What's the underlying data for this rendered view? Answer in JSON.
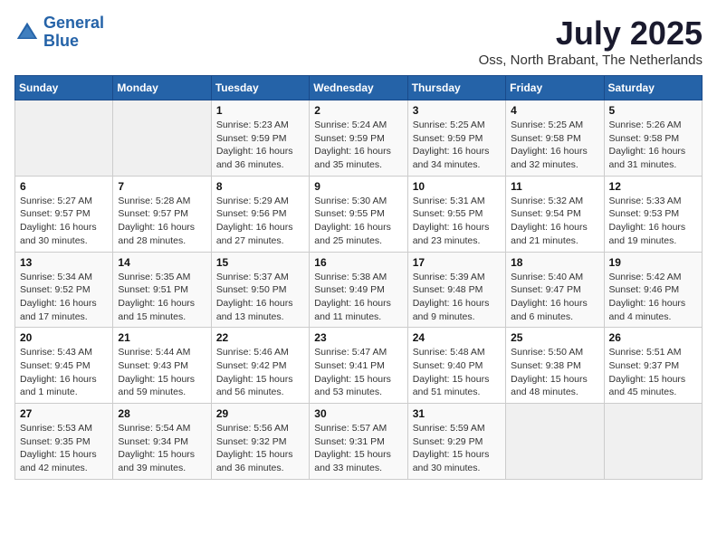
{
  "header": {
    "logo_line1": "General",
    "logo_line2": "Blue",
    "month_year": "July 2025",
    "location": "Oss, North Brabant, The Netherlands"
  },
  "weekdays": [
    "Sunday",
    "Monday",
    "Tuesday",
    "Wednesday",
    "Thursday",
    "Friday",
    "Saturday"
  ],
  "weeks": [
    [
      {
        "day": "",
        "info": ""
      },
      {
        "day": "",
        "info": ""
      },
      {
        "day": "1",
        "info": "Sunrise: 5:23 AM\nSunset: 9:59 PM\nDaylight: 16 hours\nand 36 minutes."
      },
      {
        "day": "2",
        "info": "Sunrise: 5:24 AM\nSunset: 9:59 PM\nDaylight: 16 hours\nand 35 minutes."
      },
      {
        "day": "3",
        "info": "Sunrise: 5:25 AM\nSunset: 9:59 PM\nDaylight: 16 hours\nand 34 minutes."
      },
      {
        "day": "4",
        "info": "Sunrise: 5:25 AM\nSunset: 9:58 PM\nDaylight: 16 hours\nand 32 minutes."
      },
      {
        "day": "5",
        "info": "Sunrise: 5:26 AM\nSunset: 9:58 PM\nDaylight: 16 hours\nand 31 minutes."
      }
    ],
    [
      {
        "day": "6",
        "info": "Sunrise: 5:27 AM\nSunset: 9:57 PM\nDaylight: 16 hours\nand 30 minutes."
      },
      {
        "day": "7",
        "info": "Sunrise: 5:28 AM\nSunset: 9:57 PM\nDaylight: 16 hours\nand 28 minutes."
      },
      {
        "day": "8",
        "info": "Sunrise: 5:29 AM\nSunset: 9:56 PM\nDaylight: 16 hours\nand 27 minutes."
      },
      {
        "day": "9",
        "info": "Sunrise: 5:30 AM\nSunset: 9:55 PM\nDaylight: 16 hours\nand 25 minutes."
      },
      {
        "day": "10",
        "info": "Sunrise: 5:31 AM\nSunset: 9:55 PM\nDaylight: 16 hours\nand 23 minutes."
      },
      {
        "day": "11",
        "info": "Sunrise: 5:32 AM\nSunset: 9:54 PM\nDaylight: 16 hours\nand 21 minutes."
      },
      {
        "day": "12",
        "info": "Sunrise: 5:33 AM\nSunset: 9:53 PM\nDaylight: 16 hours\nand 19 minutes."
      }
    ],
    [
      {
        "day": "13",
        "info": "Sunrise: 5:34 AM\nSunset: 9:52 PM\nDaylight: 16 hours\nand 17 minutes."
      },
      {
        "day": "14",
        "info": "Sunrise: 5:35 AM\nSunset: 9:51 PM\nDaylight: 16 hours\nand 15 minutes."
      },
      {
        "day": "15",
        "info": "Sunrise: 5:37 AM\nSunset: 9:50 PM\nDaylight: 16 hours\nand 13 minutes."
      },
      {
        "day": "16",
        "info": "Sunrise: 5:38 AM\nSunset: 9:49 PM\nDaylight: 16 hours\nand 11 minutes."
      },
      {
        "day": "17",
        "info": "Sunrise: 5:39 AM\nSunset: 9:48 PM\nDaylight: 16 hours\nand 9 minutes."
      },
      {
        "day": "18",
        "info": "Sunrise: 5:40 AM\nSunset: 9:47 PM\nDaylight: 16 hours\nand 6 minutes."
      },
      {
        "day": "19",
        "info": "Sunrise: 5:42 AM\nSunset: 9:46 PM\nDaylight: 16 hours\nand 4 minutes."
      }
    ],
    [
      {
        "day": "20",
        "info": "Sunrise: 5:43 AM\nSunset: 9:45 PM\nDaylight: 16 hours\nand 1 minute."
      },
      {
        "day": "21",
        "info": "Sunrise: 5:44 AM\nSunset: 9:43 PM\nDaylight: 15 hours\nand 59 minutes."
      },
      {
        "day": "22",
        "info": "Sunrise: 5:46 AM\nSunset: 9:42 PM\nDaylight: 15 hours\nand 56 minutes."
      },
      {
        "day": "23",
        "info": "Sunrise: 5:47 AM\nSunset: 9:41 PM\nDaylight: 15 hours\nand 53 minutes."
      },
      {
        "day": "24",
        "info": "Sunrise: 5:48 AM\nSunset: 9:40 PM\nDaylight: 15 hours\nand 51 minutes."
      },
      {
        "day": "25",
        "info": "Sunrise: 5:50 AM\nSunset: 9:38 PM\nDaylight: 15 hours\nand 48 minutes."
      },
      {
        "day": "26",
        "info": "Sunrise: 5:51 AM\nSunset: 9:37 PM\nDaylight: 15 hours\nand 45 minutes."
      }
    ],
    [
      {
        "day": "27",
        "info": "Sunrise: 5:53 AM\nSunset: 9:35 PM\nDaylight: 15 hours\nand 42 minutes."
      },
      {
        "day": "28",
        "info": "Sunrise: 5:54 AM\nSunset: 9:34 PM\nDaylight: 15 hours\nand 39 minutes."
      },
      {
        "day": "29",
        "info": "Sunrise: 5:56 AM\nSunset: 9:32 PM\nDaylight: 15 hours\nand 36 minutes."
      },
      {
        "day": "30",
        "info": "Sunrise: 5:57 AM\nSunset: 9:31 PM\nDaylight: 15 hours\nand 33 minutes."
      },
      {
        "day": "31",
        "info": "Sunrise: 5:59 AM\nSunset: 9:29 PM\nDaylight: 15 hours\nand 30 minutes."
      },
      {
        "day": "",
        "info": ""
      },
      {
        "day": "",
        "info": ""
      }
    ]
  ]
}
